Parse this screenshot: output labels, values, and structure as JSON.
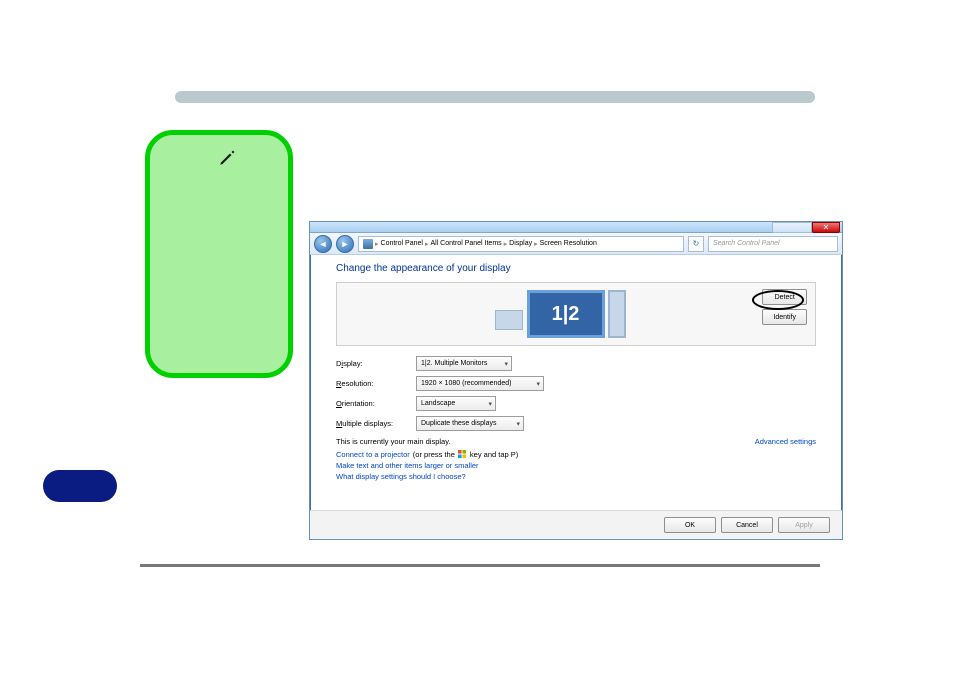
{
  "breadcrumb": {
    "items": [
      "Control Panel",
      "All Control Panel Items",
      "Display",
      "Screen Resolution"
    ]
  },
  "search": {
    "placeholder": "Search Control Panel"
  },
  "heading": "Change the appearance of your display",
  "buttons": {
    "detect": "Detect",
    "identify": "Identify",
    "ok": "OK",
    "cancel": "Cancel",
    "apply": "Apply"
  },
  "monitor_labels": {
    "combined": "1|2"
  },
  "fields": {
    "display": {
      "label_pre": "D",
      "label_ul": "i",
      "label_post": "splay:",
      "value": "1|2. Multiple Monitors"
    },
    "resolution": {
      "label_ul": "R",
      "label_post": "esolution:",
      "value": "1920 × 1080 (recommended)"
    },
    "orientation": {
      "label_ul": "O",
      "label_post": "rientation:",
      "value": "Landscape"
    },
    "multiple": {
      "label_ul": "M",
      "label_post": "ultiple displays:",
      "value": "Duplicate these displays"
    }
  },
  "main_display_text": "This is currently your main display.",
  "advanced_link": "Advanced settings",
  "links": {
    "projector_pre": "Connect to a projector",
    "projector_paren_pre": " (or press the ",
    "projector_paren_post": " key and tap P)",
    "text_size": "Make text and other items larger or smaller",
    "help": "What display settings should I choose?"
  }
}
